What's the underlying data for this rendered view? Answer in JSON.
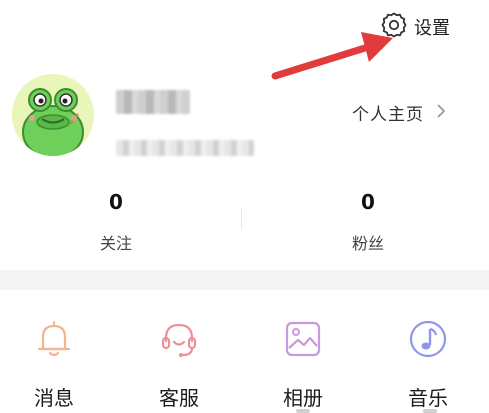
{
  "header": {
    "settings_label": "设置",
    "settings_icon": "gear-icon"
  },
  "annotation": {
    "arrow_color": "#e23b3b"
  },
  "profile": {
    "avatar_icon": "frog-avatar",
    "homepage_label": "个人主页",
    "homepage_icon": "chevron-right-icon"
  },
  "stats": {
    "following": {
      "value": "0",
      "label": "关注"
    },
    "fans": {
      "value": "0",
      "label": "粉丝"
    }
  },
  "shortcuts": [
    {
      "label": "消息",
      "icon": "bell-icon",
      "color": "#f3b48f"
    },
    {
      "label": "客服",
      "icon": "headset-icon",
      "color": "#ee8f99"
    },
    {
      "label": "相册",
      "icon": "picture-icon",
      "color": "#c79adf"
    },
    {
      "label": "音乐",
      "icon": "music-note-icon",
      "color": "#8f97ec"
    }
  ]
}
